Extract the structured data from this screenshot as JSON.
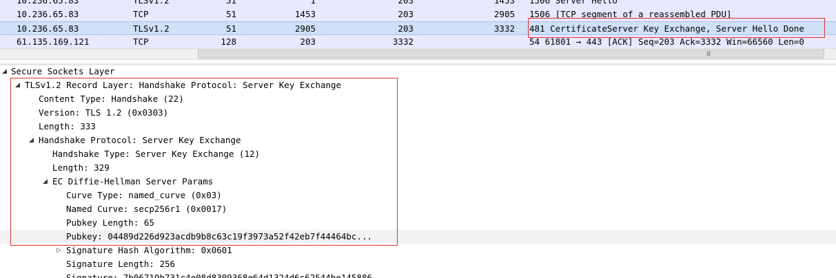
{
  "packets": [
    {
      "src": "10.236.65.83",
      "proto": "TLSv1.2",
      "a": "51",
      "b": "1",
      "c": "203",
      "d": "1453",
      "info": "1506 Server Hello"
    },
    {
      "src": "10.236.65.83",
      "proto": "TCP",
      "a": "51",
      "b": "1453",
      "c": "203",
      "d": "2905",
      "info": "1506 [TCP segment of a reassembled PDU]"
    },
    {
      "src": "10.236.65.83",
      "proto": "TLSv1.2",
      "a": "51",
      "b": "2905",
      "c": "203",
      "d": "3332",
      "info": "481 CertificateServer Key Exchange, Server Hello Done"
    },
    {
      "src": "61.135.169.121",
      "proto": "TCP",
      "a": "128",
      "b": "203",
      "c": "3332",
      "d": "",
      "info": "54 61801 → 443 [ACK] Seq=203 Ack=3332 Win=66560 Len=0"
    }
  ],
  "scrollbar_grip": "Ⅲ",
  "tree": [
    {
      "label": "Secure Sockets Layer",
      "twisty": "◢"
    },
    {
      "label": "TLSv1.2 Record Layer: Handshake Protocol: Server Key Exchange",
      "twisty": "◢"
    },
    {
      "label": "Content Type: Handshake (22)",
      "twisty": ""
    },
    {
      "label": "Version: TLS 1.2 (0x0303)",
      "twisty": ""
    },
    {
      "label": "Length: 333",
      "twisty": ""
    },
    {
      "label": "Handshake Protocol: Server Key Exchange",
      "twisty": "◢"
    },
    {
      "label": "Handshake Type: Server Key Exchange (12)",
      "twisty": ""
    },
    {
      "label": "Length: 329",
      "twisty": ""
    },
    {
      "label": "EC Diffie-Hellman Server Params",
      "twisty": "◢"
    },
    {
      "label": "Curve Type: named_curve (0x03)",
      "twisty": ""
    },
    {
      "label": "Named Curve: secp256r1 (0x0017)",
      "twisty": ""
    },
    {
      "label": "Pubkey Length: 65",
      "twisty": ""
    },
    {
      "label": "Pubkey: 04489d226d923acdb9b8c63c19f3973a52f42eb7f44464bc...",
      "twisty": ""
    },
    {
      "label": "Signature Hash Algorithm: 0x0601",
      "twisty": "▷"
    },
    {
      "label": "Signature Length: 256",
      "twisty": ""
    },
    {
      "label": "Signature: 7b06719b731c4e08d8309368e64d1324d6c62544be145886...",
      "twisty": ""
    }
  ]
}
